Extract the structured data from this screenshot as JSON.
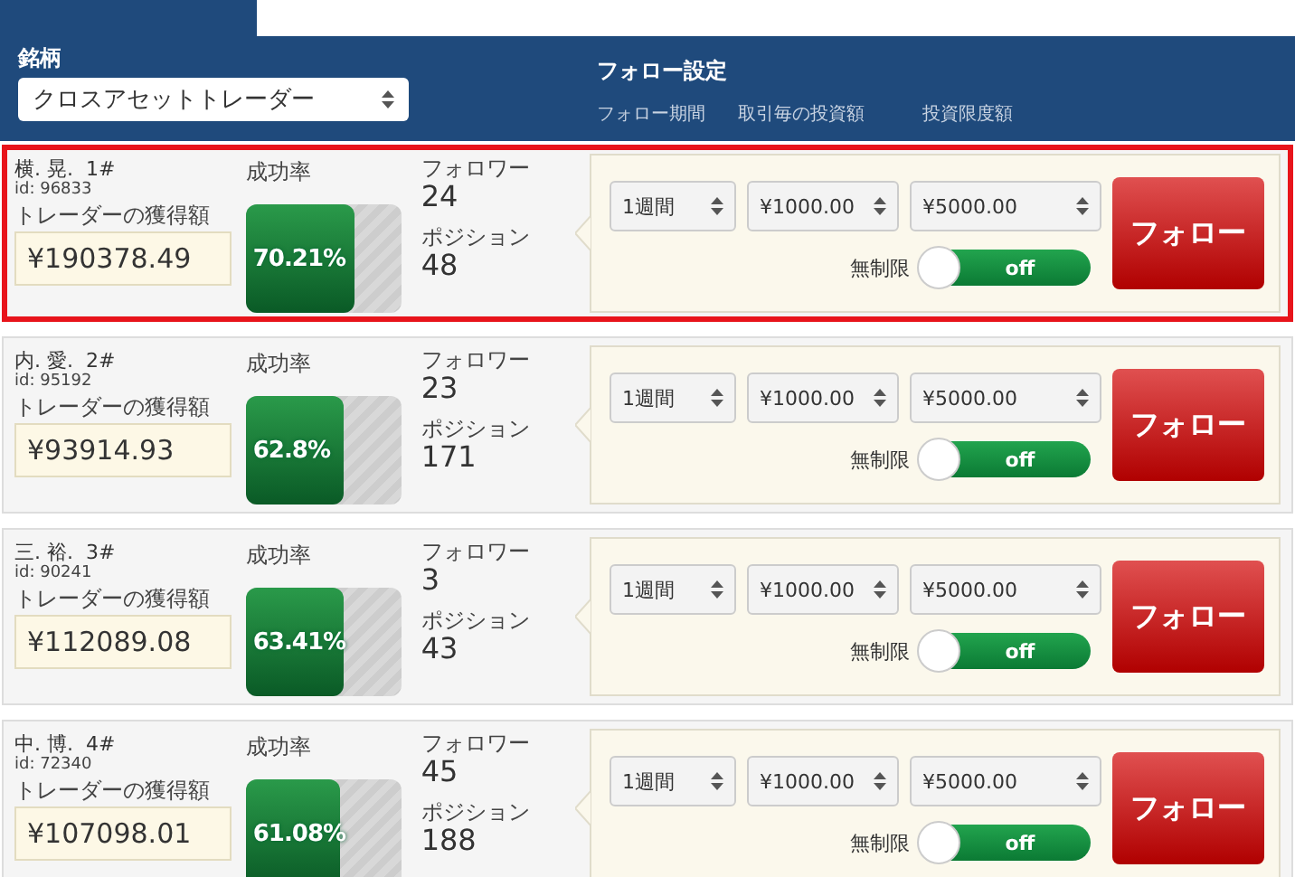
{
  "header": {
    "symbol_label": "銘柄",
    "symbol_select": "クロスアセットトレーダー",
    "settings_title": "フォロー設定",
    "columns": [
      "フォロー期間",
      "取引毎の投資額",
      "投資限度額"
    ]
  },
  "traders": [
    {
      "selected": true,
      "name": "横. 晃.",
      "rank": "1#",
      "id": "id: 96833",
      "earnings_label": "トレーダーの獲得額",
      "earnings": "¥190378.49",
      "rate_label": "成功率",
      "rate": "70.21%",
      "level": 0.7021,
      "followers_label": "フォロワー",
      "followers": "24",
      "positions_label": "ポジション",
      "positions": "48",
      "period": "1週間",
      "per_trade": "¥1000.00",
      "limit": "¥5000.00",
      "unlimited_label": "無制限",
      "unlimited_on": false,
      "toggle_text": "off",
      "follow_button": "フォロー"
    },
    {
      "selected": false,
      "name": "内. 愛.",
      "rank": "2#",
      "id": "id: 95192",
      "earnings_label": "トレーダーの獲得額",
      "earnings": "¥93914.93",
      "rate_label": "成功率",
      "rate": "62.8%",
      "level": 0.628,
      "followers_label": "フォロワー",
      "followers": "23",
      "positions_label": "ポジション",
      "positions": "171",
      "period": "1週間",
      "per_trade": "¥1000.00",
      "limit": "¥5000.00",
      "unlimited_label": "無制限",
      "unlimited_on": false,
      "toggle_text": "off",
      "follow_button": "フォロー"
    },
    {
      "selected": false,
      "name": "三. 裕.",
      "rank": "3#",
      "id": "id: 90241",
      "earnings_label": "トレーダーの獲得額",
      "earnings": "¥112089.08",
      "rate_label": "成功率",
      "rate": "63.41%",
      "level": 0.6341,
      "followers_label": "フォロワー",
      "followers": "3",
      "positions_label": "ポジション",
      "positions": "43",
      "period": "1週間",
      "per_trade": "¥1000.00",
      "limit": "¥5000.00",
      "unlimited_label": "無制限",
      "unlimited_on": false,
      "toggle_text": "off",
      "follow_button": "フォロー"
    },
    {
      "selected": false,
      "name": "中. 博.",
      "rank": "4#",
      "id": "id: 72340",
      "earnings_label": "トレーダーの獲得額",
      "earnings": "¥107098.01",
      "rate_label": "成功率",
      "rate": "61.08%",
      "level": 0.6108,
      "followers_label": "フォロワー",
      "followers": "45",
      "positions_label": "ポジション",
      "positions": "188",
      "period": "1週間",
      "per_trade": "¥1000.00",
      "limit": "¥5000.00",
      "unlimited_label": "無制限",
      "unlimited_on": false,
      "toggle_text": "off",
      "follow_button": "フォロー"
    }
  ]
}
